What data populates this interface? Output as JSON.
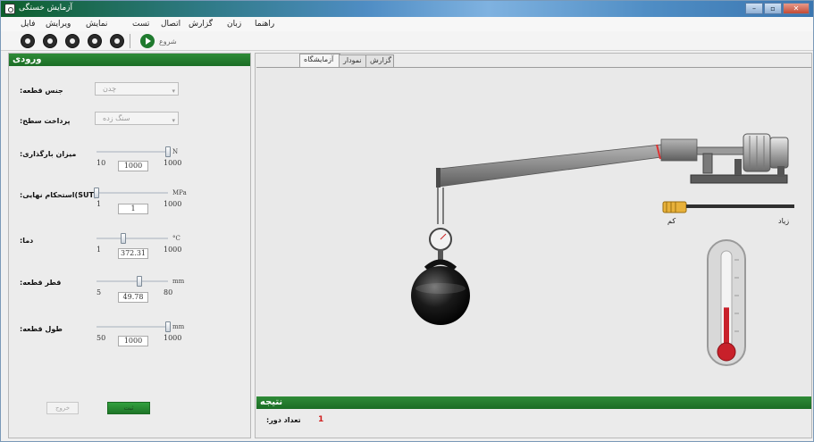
{
  "window": {
    "title": "آزمایش خستگی"
  },
  "menu": {
    "items": [
      {
        "label": "فایل"
      },
      {
        "label": "ویرایش"
      },
      {
        "label": "نمایش"
      },
      {
        "label": "تست"
      },
      {
        "label": "اتصال"
      },
      {
        "label": "گزارش"
      },
      {
        "label": "زبان"
      },
      {
        "label": "راهنما"
      }
    ]
  },
  "toolbar": {
    "buttons": [
      {
        "icon": "record-icon"
      },
      {
        "icon": "stop-icon"
      },
      {
        "icon": "save-icon"
      },
      {
        "icon": "print-icon"
      },
      {
        "icon": "info-icon"
      }
    ],
    "start_label": "شروع"
  },
  "input_panel": {
    "title": "ورودی",
    "material": {
      "label": ":جنس قطعه",
      "value": "چدن"
    },
    "finish": {
      "label": ":پرداخت سطح",
      "value": "سنگ زده"
    },
    "load": {
      "label": ":میزان بارگذاری",
      "unit": "N",
      "min": "10",
      "max": "1000",
      "value": "1000",
      "fraction": 1.0
    },
    "sut": {
      "label": ":استحکام نهایی(SUT)",
      "unit": "MPa",
      "min": "1",
      "max": "1000",
      "value": "1",
      "fraction": 0.0
    },
    "temp": {
      "label": ":دما",
      "unit": "°C",
      "min": "1",
      "max": "1000",
      "value": "372.31",
      "fraction": 0.37
    },
    "diameter": {
      "label": ":قطر قطعه",
      "unit": "mm",
      "min": "5",
      "max": "80",
      "value": "49.78",
      "fraction": 0.6
    },
    "length": {
      "label": ":طول قطعه",
      "unit": "mm",
      "min": "50",
      "max": "1000",
      "value": "1000",
      "fraction": 1.0
    },
    "exit_label": "خروج",
    "ok_label": "ثبت"
  },
  "tabs": [
    {
      "label": "آزمایشگاه",
      "active": true
    },
    {
      "label": "نمودار",
      "active": false
    },
    {
      "label": "گزارش",
      "active": false
    }
  ],
  "speed_scale": {
    "low_label": "کم",
    "high_label": "زیاد"
  },
  "thermometer": {
    "level": 0.45
  },
  "result": {
    "title": "نتیجه",
    "cycles_label": ":تعداد دور",
    "cycles_value": "1"
  },
  "colors": {
    "panel_green": "#1f7a2a",
    "accent_red": "#c8202a"
  }
}
